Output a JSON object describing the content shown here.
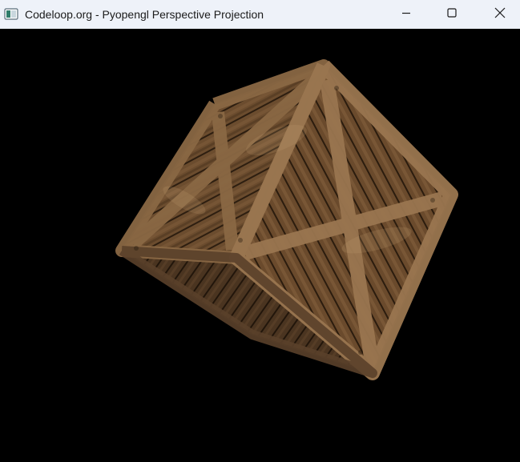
{
  "window": {
    "title": "Codeloop.org - Pyopengl Perspective Projection",
    "icon": "app-window-icon",
    "controls": {
      "minimize_icon": "minimize-icon",
      "maximize_icon": "maximize-icon",
      "close_icon": "close-icon"
    }
  },
  "scene": {
    "object": "textured-wooden-crate",
    "background_color": "#000000",
    "colors": {
      "wood_dark": "#3d2a18",
      "wood_mid": "#6b4c2e",
      "wood_light": "#a07a50"
    }
  }
}
